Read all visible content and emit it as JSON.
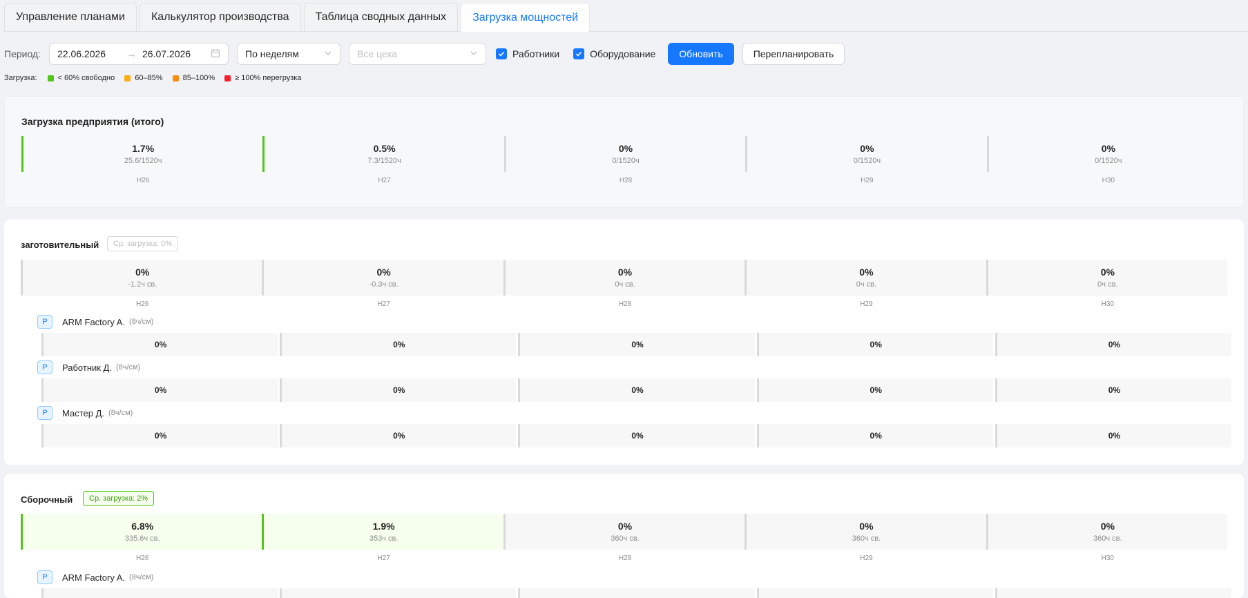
{
  "tabs": [
    {
      "label": "Управление планами",
      "active": false
    },
    {
      "label": "Калькулятор производства",
      "active": false
    },
    {
      "label": "Таблица сводных данных",
      "active": false
    },
    {
      "label": "Загрузка мощностей",
      "active": true
    }
  ],
  "toolbar": {
    "period_label": "Период:",
    "date_from": "22.06.2026",
    "date_to": "26.07.2026",
    "grouping": "По неделям",
    "workshops_placeholder": "Все цеха",
    "workers_label": "Работники",
    "workers_checked": true,
    "equipment_label": "Оборудование",
    "equipment_checked": true,
    "refresh_label": "Обновить",
    "replan_label": "Перепланировать"
  },
  "legend": {
    "label": "Загрузка:",
    "items": [
      {
        "label": "< 60% свободно",
        "color": "#52c41a"
      },
      {
        "label": "60–85%",
        "color": "#faad14"
      },
      {
        "label": "85–100%",
        "color": "#fa8c16"
      },
      {
        "label": "≥ 100% перегрузка",
        "color": "#f5222d"
      }
    ]
  },
  "total": {
    "title": "Загрузка предприятия (итого)",
    "weeks": [
      {
        "pct": "1.7%",
        "sub": "25.6/1520ч",
        "week": "Н26",
        "level": "green"
      },
      {
        "pct": "0.5%",
        "sub": "7.3/1520ч",
        "week": "Н27",
        "level": "green"
      },
      {
        "pct": "0%",
        "sub": "0/1520ч",
        "week": "Н28",
        "level": "none"
      },
      {
        "pct": "0%",
        "sub": "0/1520ч",
        "week": "Н29",
        "level": "none"
      },
      {
        "pct": "0%",
        "sub": "0/1520ч",
        "week": "Н30",
        "level": "none"
      }
    ]
  },
  "workshops": [
    {
      "name": "заготовительный",
      "avg": "Ср. загрузка: 0%",
      "weeks": [
        {
          "pct": "0%",
          "sub": "-1.2ч св.",
          "week": "Н26",
          "level": "none"
        },
        {
          "pct": "0%",
          "sub": "-0.3ч св.",
          "week": "Н27",
          "level": "none"
        },
        {
          "pct": "0%",
          "sub": "0ч св.",
          "week": "Н28",
          "level": "none"
        },
        {
          "pct": "0%",
          "sub": "0ч св.",
          "week": "Н29",
          "level": "none"
        },
        {
          "pct": "0%",
          "sub": "0ч св.",
          "week": "Н30",
          "level": "none"
        }
      ],
      "workers": [
        {
          "badge": "Р",
          "name": "ARM Factory A.",
          "rate": "(8ч/см)",
          "values": [
            "0%",
            "0%",
            "0%",
            "0%",
            "0%"
          ]
        },
        {
          "badge": "Р",
          "name": "Работник Д.",
          "rate": "(8ч/см)",
          "values": [
            "0%",
            "0%",
            "0%",
            "0%",
            "0%"
          ]
        },
        {
          "badge": "Р",
          "name": "Мастер Д.",
          "rate": "(8ч/см)",
          "values": [
            "0%",
            "0%",
            "0%",
            "0%",
            "0%"
          ]
        }
      ]
    },
    {
      "name": "Сборочный",
      "avg": "Ср. загрузка: 2%",
      "weeks": [
        {
          "pct": "6.8%",
          "sub": "335.6ч св.",
          "week": "Н26",
          "level": "green"
        },
        {
          "pct": "1.9%",
          "sub": "353ч св.",
          "week": "Н27",
          "level": "green"
        },
        {
          "pct": "0%",
          "sub": "360ч св.",
          "week": "Н28",
          "level": "none"
        },
        {
          "pct": "0%",
          "sub": "360ч св.",
          "week": "Н29",
          "level": "none"
        },
        {
          "pct": "0%",
          "sub": "360ч св.",
          "week": "Н30",
          "level": "none"
        }
      ],
      "workers": [
        {
          "badge": "Р",
          "name": "ARM Factory A.",
          "rate": "(8ч/см)",
          "values": [
            "",
            "",
            "",
            "",
            ""
          ]
        }
      ]
    }
  ]
}
